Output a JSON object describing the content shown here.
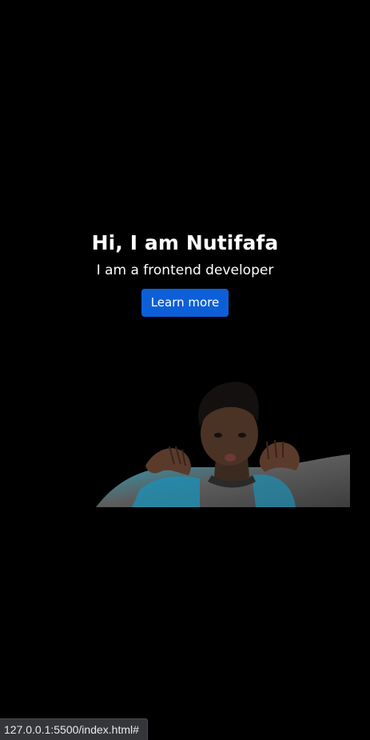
{
  "hero": {
    "title": "Hi, I am Nutifafa",
    "subtitle": "I am a frontend developer",
    "button_label": "Learn more"
  },
  "status_bar": {
    "url": "127.0.0.1:5500/index.html#"
  },
  "colors": {
    "background": "#000000",
    "text": "#ffffff",
    "button": "#0d5fd8",
    "status_bar": "#35363a"
  }
}
